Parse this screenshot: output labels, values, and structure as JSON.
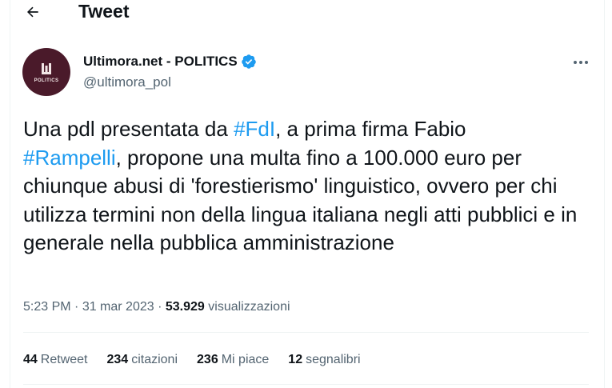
{
  "header": {
    "title": "Tweet",
    "back_icon": "arrow-left-icon"
  },
  "author": {
    "display_name": "Ultimora.net - POLITICS",
    "handle": "@ultimora_pol",
    "avatar_text": "POLITICS",
    "verified_color": "#1d9bf0"
  },
  "tweet": {
    "text_parts": [
      "Una pdl presentata da ",
      "#FdI",
      ", a prima firma Fabio\n",
      "#Rampelli",
      ", propone una multa fino a 100.000 euro per chiunque abusi di 'forestierismo' linguistico, ovvero per chi utilizza termini non della lingua italiana negli atti pubblici e in generale nella pubblica amministrazione"
    ],
    "time": "5:23 PM",
    "sep1": " · ",
    "date": "31 mar 2023",
    "sep2": " · ",
    "views_count": "53.929",
    "views_label": " visualizzazioni"
  },
  "stats": [
    {
      "count": "44",
      "label": "Retweet"
    },
    {
      "count": "234",
      "label": "citazioni"
    },
    {
      "count": "236",
      "label": "Mi piace"
    },
    {
      "count": "12",
      "label": "segnalibri"
    }
  ],
  "colors": {
    "link": "#1d9bf0",
    "secondary_text": "#536471",
    "avatar_bg": "#4a1a2a"
  }
}
